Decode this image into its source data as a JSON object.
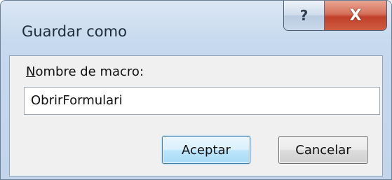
{
  "window": {
    "title": "Guardar como",
    "help_glyph": "?",
    "close_glyph": "X",
    "help_icon": "question-mark-icon",
    "close_icon": "close-x-icon"
  },
  "form": {
    "label_mnemonic": "N",
    "label_rest": "ombre de macro:",
    "macro_name_value": "ObrirFormulari"
  },
  "buttons": {
    "accept_label": "Aceptar",
    "cancel_label": "Cancelar"
  },
  "colors": {
    "frame_top": "#dbe7f4",
    "frame_bottom": "#c2d5ea",
    "close_button": "#c1402a",
    "default_button_border": "#3c7fb1"
  }
}
